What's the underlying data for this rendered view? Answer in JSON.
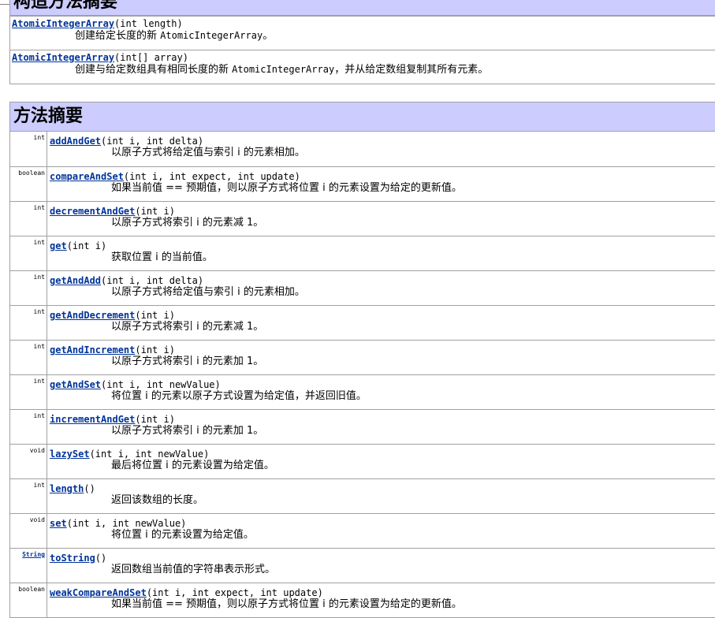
{
  "constructor_summary": {
    "title": "构造方法摘要",
    "rows": [
      {
        "name": "AtomicIntegerArray",
        "params": "(int length)",
        "desc_before": "创建给定长度的新 ",
        "desc_code": "AtomicIntegerArray",
        "desc_after": "。"
      },
      {
        "name": "AtomicIntegerArray",
        "params": "(int[] array)",
        "desc_before": "创建与给定数组具有相同长度的新 ",
        "desc_code": "AtomicIntegerArray",
        "desc_after": "，并从给定数组复制其所有元素。"
      }
    ]
  },
  "method_summary": {
    "title": "方法摘要",
    "rows": [
      {
        "type": "int",
        "name": "addAndGet",
        "params": "(int i, int delta)",
        "desc": "以原子方式将给定值与索引 i 的元素相加。"
      },
      {
        "type": "boolean",
        "name": "compareAndSet",
        "params": "(int i, int expect, int update)",
        "desc": "如果当前值 == 预期值，则以原子方式将位置 i 的元素设置为给定的更新值。"
      },
      {
        "type": "int",
        "name": "decrementAndGet",
        "params": "(int i)",
        "desc": "以原子方式将索引 i 的元素减 1。"
      },
      {
        "type": "int",
        "name": "get",
        "params": "(int i)",
        "desc": "获取位置 i 的当前值。"
      },
      {
        "type": "int",
        "name": "getAndAdd",
        "params": "(int i, int delta)",
        "desc": "以原子方式将给定值与索引 i 的元素相加。"
      },
      {
        "type": "int",
        "name": "getAndDecrement",
        "params": "(int i)",
        "desc": "以原子方式将索引 i 的元素减 1。"
      },
      {
        "type": "int",
        "name": "getAndIncrement",
        "params": "(int i)",
        "desc": "以原子方式将索引 i 的元素加 1。"
      },
      {
        "type": "int",
        "name": "getAndSet",
        "params": "(int i, int newValue)",
        "desc": "将位置 i 的元素以原子方式设置为给定值，并返回旧值。"
      },
      {
        "type": "int",
        "name": "incrementAndGet",
        "params": "(int i)",
        "desc": "以原子方式将索引 i 的元素加 1。"
      },
      {
        "type": "void",
        "name": "lazySet",
        "params": "(int i, int newValue)",
        "desc": "最后将位置 i 的元素设置为给定值。"
      },
      {
        "type": "int",
        "name": "length",
        "params": "()",
        "desc": "返回该数组的长度。"
      },
      {
        "type": "void",
        "name": "set",
        "params": "(int i, int newValue)",
        "desc": "将位置 i 的元素设置为给定值。"
      },
      {
        "type": "String",
        "name": "toString",
        "params": "()",
        "desc": "返回数组当前值的字符串表示形式。",
        "type_is_link": true
      },
      {
        "type": "boolean",
        "name": "weakCompareAndSet",
        "params": "(int i, int expect, int update)",
        "desc": "如果当前值 == 预期值，则以原子方式将位置 i 的元素设置为给定的更新值。"
      }
    ]
  },
  "colors": {
    "header_bg": "#ccccff",
    "link": "#003399",
    "border": "#a0a0a0"
  }
}
